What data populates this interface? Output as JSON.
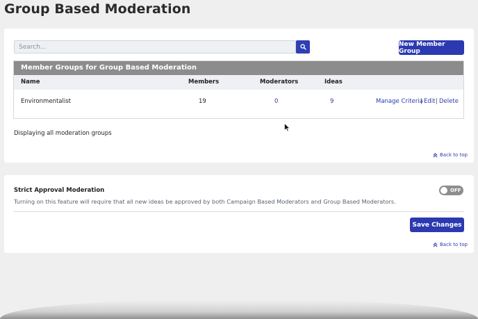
{
  "page": {
    "title": "Group Based Moderation"
  },
  "search": {
    "placeholder": "Search...",
    "value": ""
  },
  "toolbar": {
    "new_group_label": "New Member Group"
  },
  "table": {
    "title": "Member Groups for Group Based Moderation",
    "columns": {
      "name": "Name",
      "members": "Members",
      "moderators": "Moderators",
      "ideas": "Ideas"
    },
    "rows": [
      {
        "name": "Environmentalist",
        "members": "19",
        "moderators": "0",
        "ideas": "9",
        "manage_criteria": "Manage Criteria",
        "edit": "Edit",
        "delete": "Delete",
        "separator": "|"
      }
    ]
  },
  "status": {
    "displaying": "Displaying all moderation groups"
  },
  "back_to_top": "Back to top",
  "strict": {
    "title": "Strict Approval Moderation",
    "description": "Turning on this feature will require that all new ideas be approved by both Campaign Based Moderators and Group Based Moderators.",
    "toggle_state": "OFF",
    "save_label": "Save Changes"
  },
  "colors": {
    "accent": "#2b3ab0",
    "table_header": "#8c8c8c",
    "background": "#efefef"
  },
  "icons": {
    "search": "search-icon",
    "back_to_top": "double-chevron-up-icon"
  }
}
